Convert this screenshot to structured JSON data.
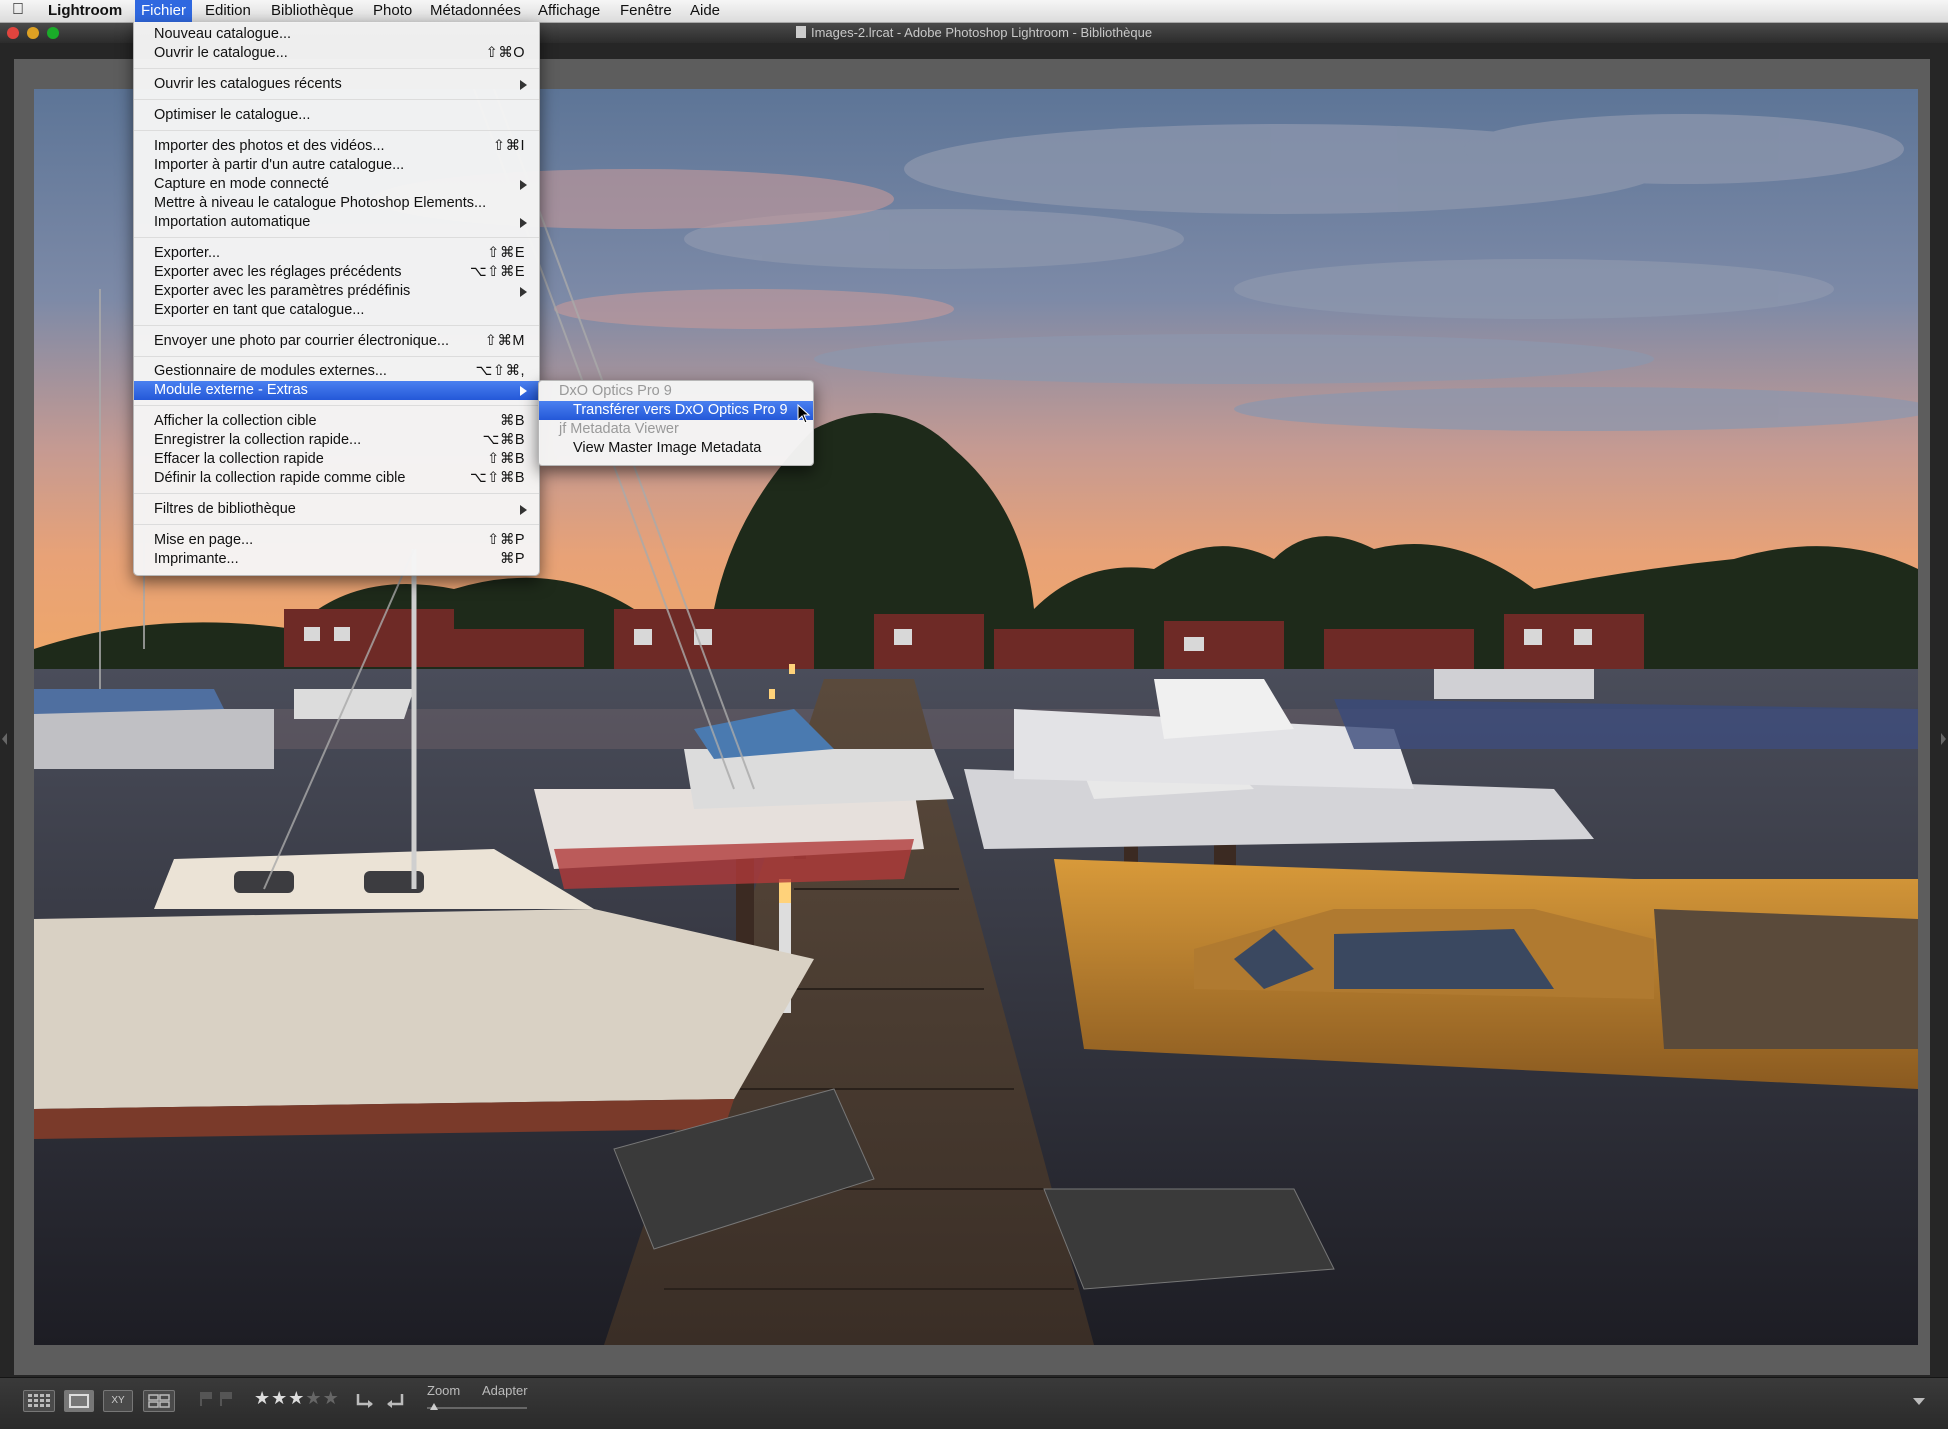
{
  "menubar": {
    "app": "Lightroom",
    "items": [
      "Fichier",
      "Edition",
      "Bibliothèque",
      "Photo",
      "Métadonnées",
      "Affichage",
      "Fenêtre",
      "Aide"
    ]
  },
  "window": {
    "title": "Images-2.lrcat - Adobe Photoshop Lightroom - Bibliothèque"
  },
  "file_menu": {
    "items": [
      {
        "label": "Nouveau catalogue...",
        "shortcut": ""
      },
      {
        "label": "Ouvrir le catalogue...",
        "shortcut": "⇧⌘O"
      },
      {
        "label": "Ouvrir les catalogues récents",
        "shortcut": ""
      },
      {
        "label": "Optimiser le catalogue...",
        "shortcut": ""
      },
      {
        "label": "Importer des photos et des vidéos...",
        "shortcut": "⇧⌘I"
      },
      {
        "label": "Importer à partir d'un autre catalogue...",
        "shortcut": ""
      },
      {
        "label": "Capture en mode connecté",
        "shortcut": ""
      },
      {
        "label": "Mettre à niveau le catalogue Photoshop Elements...",
        "shortcut": ""
      },
      {
        "label": "Importation automatique",
        "shortcut": ""
      },
      {
        "label": "Exporter...",
        "shortcut": "⇧⌘E"
      },
      {
        "label": "Exporter avec les réglages précédents",
        "shortcut": "⌥⇧⌘E"
      },
      {
        "label": "Exporter avec les paramètres prédéfinis",
        "shortcut": ""
      },
      {
        "label": "Exporter en tant que catalogue...",
        "shortcut": ""
      },
      {
        "label": "Envoyer une photo par courrier électronique...",
        "shortcut": "⇧⌘M"
      },
      {
        "label": "Gestionnaire de modules externes...",
        "shortcut": "⌥⇧⌘,"
      },
      {
        "label": "Module externe - Extras",
        "shortcut": ""
      },
      {
        "label": "Afficher la collection cible",
        "shortcut": "⌘B"
      },
      {
        "label": "Enregistrer la collection rapide...",
        "shortcut": "⌥⌘B"
      },
      {
        "label": "Effacer la collection rapide",
        "shortcut": "⇧⌘B"
      },
      {
        "label": "Définir la collection rapide comme cible",
        "shortcut": "⌥⇧⌘B"
      },
      {
        "label": "Filtres de bibliothèque",
        "shortcut": ""
      },
      {
        "label": "Mise en page...",
        "shortcut": "⇧⌘P"
      },
      {
        "label": "Imprimante...",
        "shortcut": "⌘P"
      }
    ]
  },
  "submenu": {
    "items": [
      {
        "label": "DxO Optics Pro 9"
      },
      {
        "label": "Transférer vers DxO Optics Pro 9"
      },
      {
        "label": "jf Metadata Viewer"
      },
      {
        "label": "View Master Image Metadata"
      }
    ]
  },
  "toolbar": {
    "view_buttons": [
      "grid-view",
      "loupe-view",
      "compare-view",
      "survey-view"
    ],
    "compare_text": "XY",
    "rating": 3,
    "stars": [
      "★",
      "★",
      "★",
      "★",
      "★"
    ],
    "zoom_label": "Zoom",
    "fit_label": "Adapter"
  }
}
